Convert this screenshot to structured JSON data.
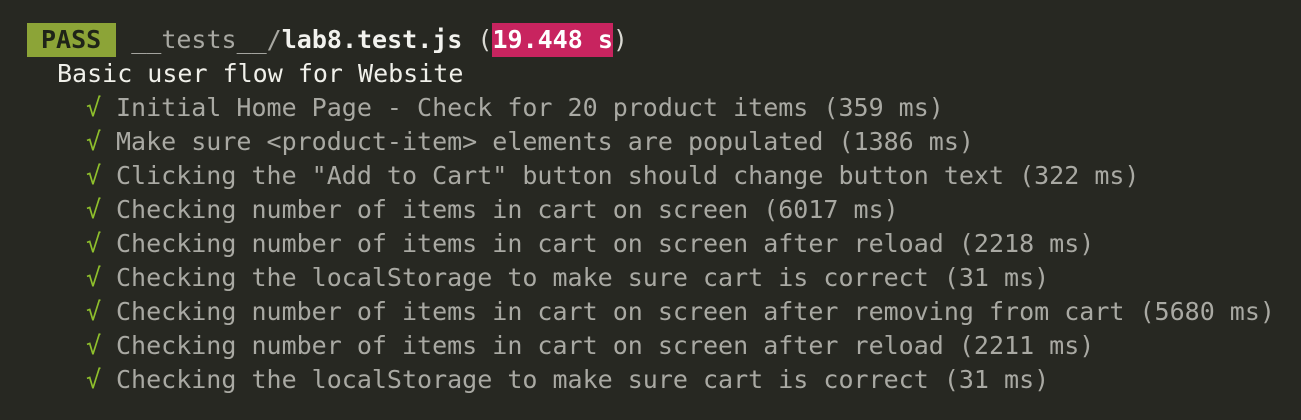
{
  "header": {
    "status": "PASS",
    "path_dir": "__tests__/",
    "path_file": "lab8.test.js",
    "open_paren": " (",
    "duration": "19.448 s",
    "close_paren": ")"
  },
  "suite": {
    "title": "Basic user flow for Website"
  },
  "tests": [
    {
      "icon": "√",
      "text": "Initial Home Page - Check for 20 product items (359 ms)"
    },
    {
      "icon": "√",
      "text": "Make sure <product-item> elements are populated (1386 ms)"
    },
    {
      "icon": "√",
      "text": "Clicking the \"Add to Cart\" button should change button text (322 ms)"
    },
    {
      "icon": "√",
      "text": "Checking number of items in cart on screen (6017 ms)"
    },
    {
      "icon": "√",
      "text": "Checking number of items in cart on screen after reload (2218 ms)"
    },
    {
      "icon": "√",
      "text": "Checking the localStorage to make sure cart is correct (31 ms)"
    },
    {
      "icon": "√",
      "text": "Checking number of items in cart on screen after removing from cart (5680 ms)"
    },
    {
      "icon": "√",
      "text": "Checking number of items in cart on screen after reload (2211 ms)"
    },
    {
      "icon": "√",
      "text": "Checking the localStorage to make sure cart is correct (31 ms)"
    }
  ],
  "colors": {
    "background": "#272822",
    "pass_badge": "#8ca437",
    "duration_badge": "#c8245f",
    "check_mark": "#8ebf2c"
  }
}
